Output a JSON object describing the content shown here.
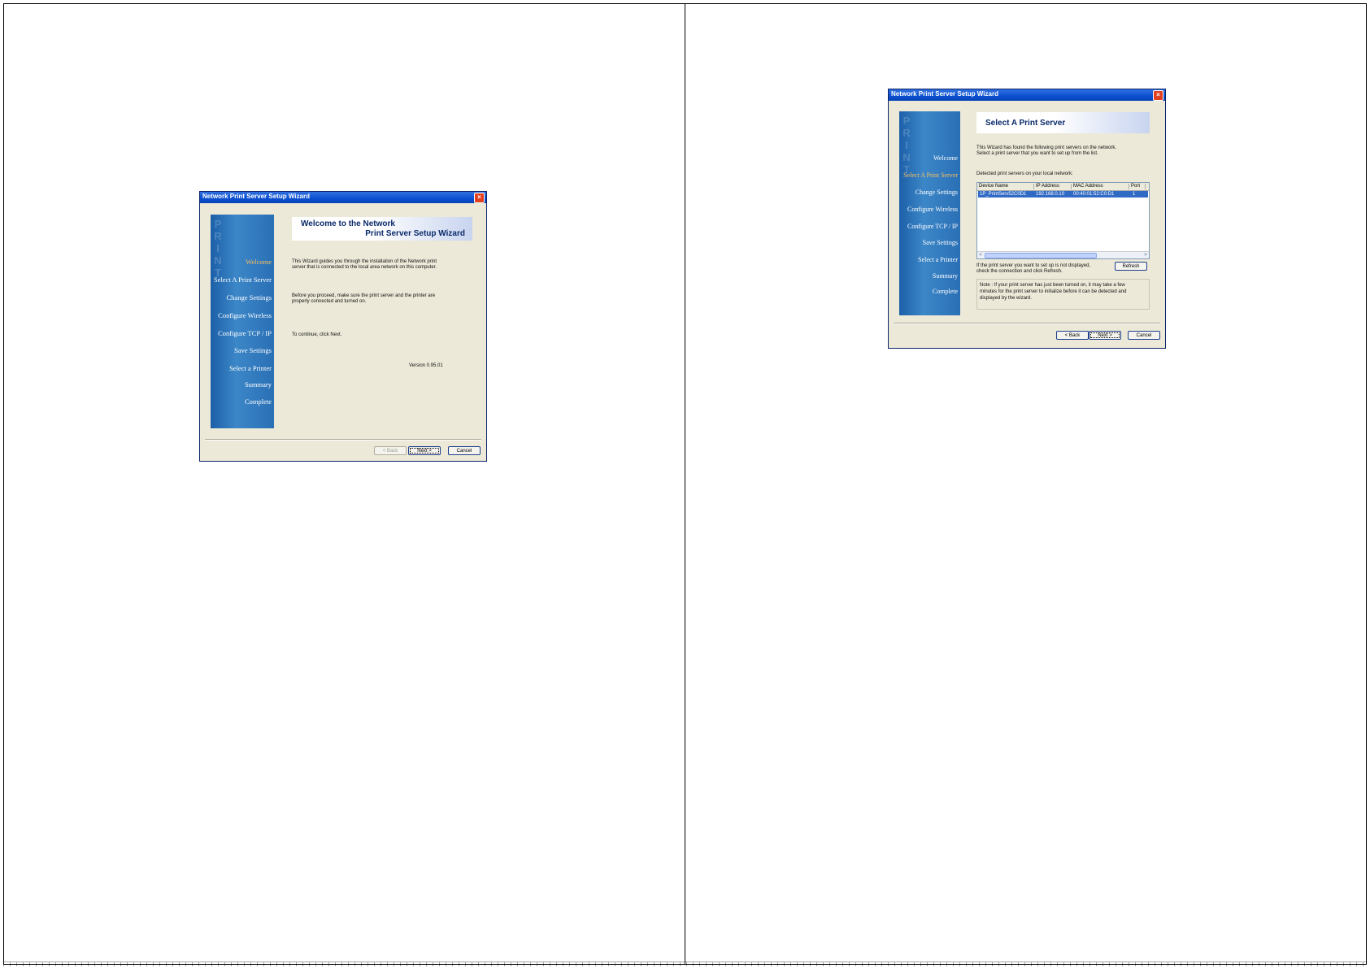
{
  "wizard_welcome": {
    "title": "Network Print Server Setup Wizard",
    "close_label": "×",
    "watermark": "PRINT",
    "nav": [
      "Welcome",
      "Select A Print Server",
      "Change Settings",
      "Configure Wireless",
      "Configure TCP / IP",
      "Save Settings",
      "Select a Printer",
      "Summary",
      "Complete"
    ],
    "active_step": "Welcome",
    "header_line1": "Welcome to the Network",
    "header_line2": "Print Server Setup Wizard",
    "intro_line1": "This Wizard guides you through the installation of the Network print",
    "intro_line2": "server that is connected to the local area network on this computer.",
    "proceed_line1": "Before you proceed, make sure the print server and the printer are",
    "proceed_line2": "properly connected and turned on.",
    "continue_text": "To continue, click Next.",
    "version": "Version 0.95.01",
    "back_label": "< Back",
    "next_label": "Next >",
    "cancel_label": "Cancel"
  },
  "wizard_select": {
    "title": "Network Print Server Setup Wizard",
    "close_label": "×",
    "watermark": "PRINT",
    "nav": [
      "Welcome",
      "Select A Print Server",
      "Change Settings",
      "Configure Wireless",
      "Configure TCP / IP",
      "Save Settings",
      "Select a Printer",
      "Summary",
      "Complete"
    ],
    "active_step": "Select A Print Server",
    "header_title": "Select A Print Server",
    "found_line1": "This Wizard has found the following print servers on the network.",
    "found_line2": "Select a print server that you want to set up from the list.",
    "detected_label": "Detected print servers on your local network:",
    "columns": [
      "Device Name",
      "IP Address",
      "MAC Address",
      "Port"
    ],
    "rows": [
      {
        "device_name": "1P_PrintServ52C0D1",
        "ip_address": "192.168.0.10",
        "mac_address": "00:40:01:52:C0:D1",
        "port": "1"
      }
    ],
    "scroll_left": "<",
    "scroll_right": ">",
    "not_displayed_line1": "If the print server you want to set up is not displayed,",
    "not_displayed_line2": "check the connection and click Refresh.",
    "refresh_label": "Refresh",
    "note_line1": "Note : If your print server has just been turned on, it may take a few",
    "note_line2": "minutes for the print server to initialize before it can be detected and",
    "note_line3": "displayed by the wizard.",
    "back_label": "< Back",
    "next_label": "Next >",
    "cancel_label": "Cancel"
  }
}
